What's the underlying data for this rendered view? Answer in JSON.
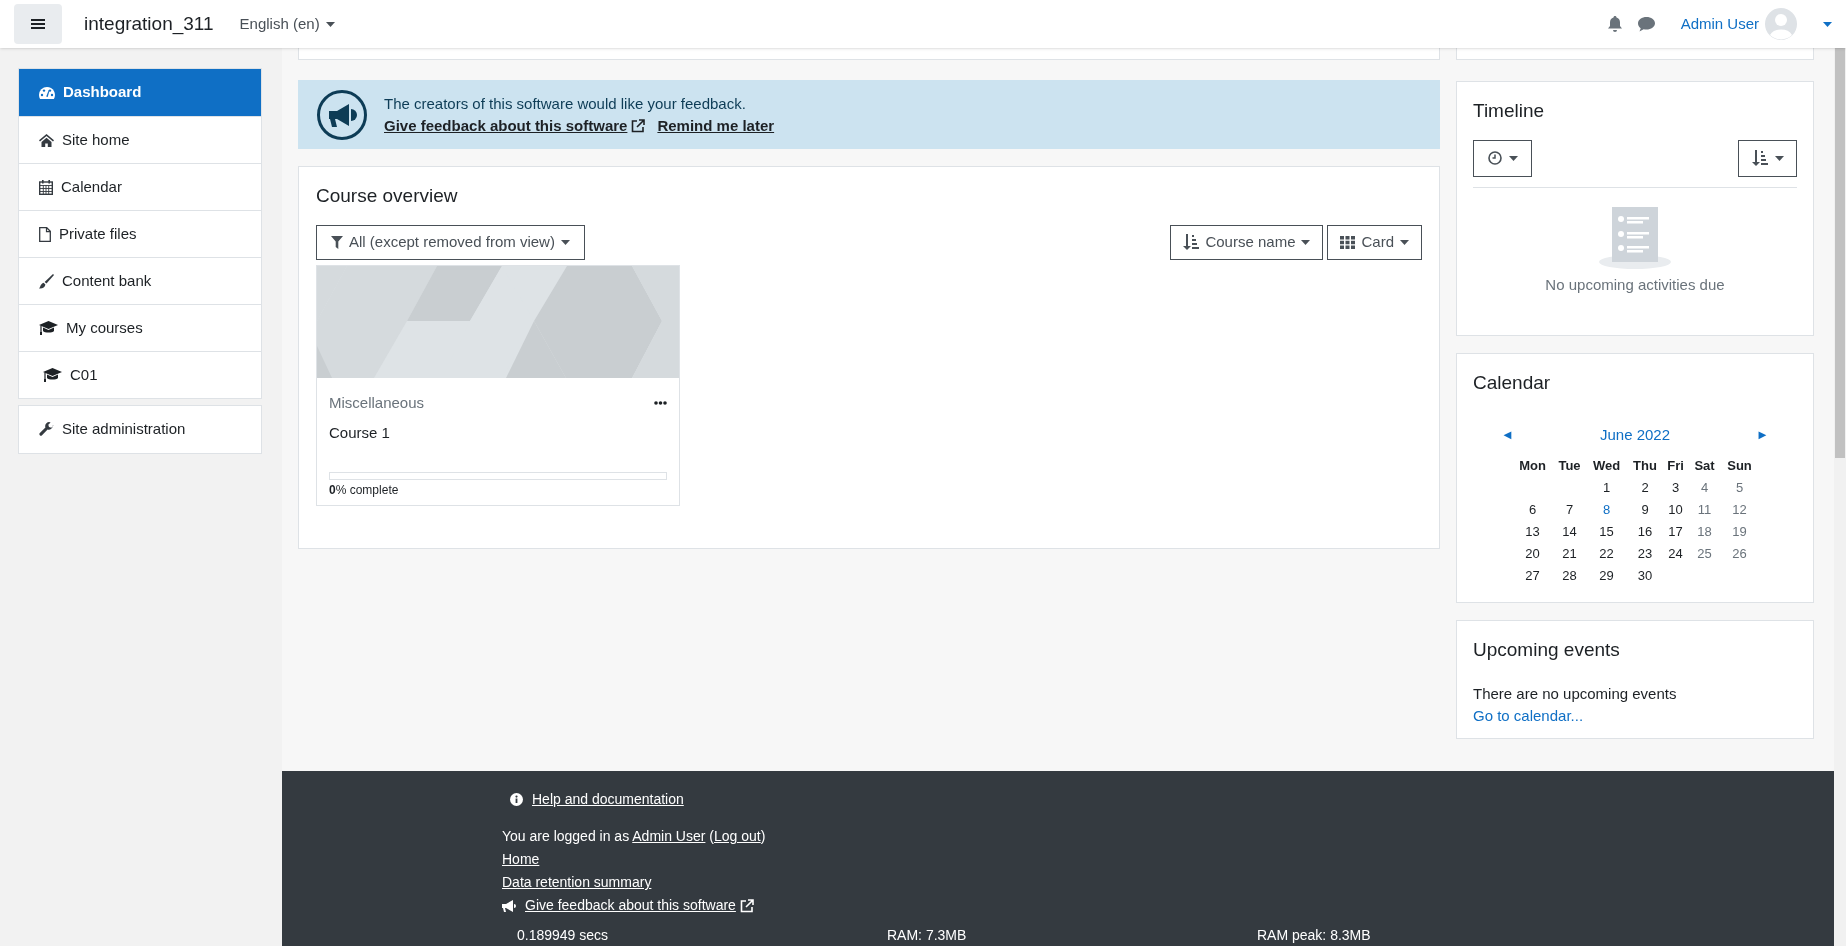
{
  "navbar": {
    "site_name": "integration_311",
    "language": "English (en)",
    "user_name": "Admin User"
  },
  "sidebar": {
    "items": [
      {
        "label": "Dashboard",
        "selected": true
      },
      {
        "label": "Site home",
        "selected": false
      },
      {
        "label": "Calendar",
        "selected": false
      },
      {
        "label": "Private files",
        "selected": false
      },
      {
        "label": "Content bank",
        "selected": false
      },
      {
        "label": "My courses",
        "selected": false,
        "children": [
          {
            "label": "C01",
            "selected": false
          }
        ]
      }
    ],
    "admin_item": {
      "label": "Site administration",
      "selected": false
    }
  },
  "feedback_banner": {
    "message": "The creators of this software would like your feedback.",
    "give_feedback_link": "Give feedback about this software",
    "remind_link": "Remind me later"
  },
  "course_overview": {
    "title": "Course overview",
    "filter": "All (except removed from view)",
    "sort": "Course name",
    "view": "Card",
    "courses": [
      {
        "category": "Miscellaneous",
        "name": "Course 1",
        "level": 0,
        "progress_value": "0",
        "progress_suffix": "% complete"
      }
    ]
  },
  "timeline": {
    "title": "Timeline",
    "empty_message": "No upcoming activities due"
  },
  "calendar": {
    "title": "Calendar",
    "prev": "◄",
    "month": "June 2022",
    "next": "►",
    "weekdays": [
      "Mon",
      "Tue",
      "Wed",
      "Thu",
      "Fri",
      "Sat",
      "Sun"
    ],
    "weeks": [
      [
        {
          "day": "1",
          "kind": "weekday"
        },
        {
          "day": "2",
          "kind": "weekday"
        },
        {
          "day": "3",
          "kind": "weekday"
        },
        {
          "day": "4",
          "kind": "weekend"
        },
        {
          "day": "5",
          "kind": "weekend"
        }
      ],
      [
        {
          "day": "6",
          "kind": "weekday"
        },
        {
          "day": "7",
          "kind": "weekday"
        },
        {
          "day": "8",
          "kind": "today"
        },
        {
          "day": "9",
          "kind": "weekday"
        },
        {
          "day": "10",
          "kind": "weekday"
        },
        {
          "day": "11",
          "kind": "weekend"
        },
        {
          "day": "12",
          "kind": "weekend"
        }
      ],
      [
        {
          "day": "13",
          "kind": "weekday"
        },
        {
          "day": "14",
          "kind": "weekday"
        },
        {
          "day": "15",
          "kind": "weekday"
        },
        {
          "day": "16",
          "kind": "weekday"
        },
        {
          "day": "17",
          "kind": "weekday"
        },
        {
          "day": "18",
          "kind": "weekend"
        },
        {
          "day": "19",
          "kind": "weekend"
        }
      ],
      [
        {
          "day": "20",
          "kind": "weekday"
        },
        {
          "day": "21",
          "kind": "weekday"
        },
        {
          "day": "22",
          "kind": "weekday"
        },
        {
          "day": "23",
          "kind": "weekday"
        },
        {
          "day": "24",
          "kind": "weekday"
        },
        {
          "day": "25",
          "kind": "weekend"
        },
        {
          "day": "26",
          "kind": "weekend"
        }
      ],
      [
        {
          "day": "27",
          "kind": "weekday"
        },
        {
          "day": "28",
          "kind": "weekday"
        },
        {
          "day": "29",
          "kind": "weekday"
        },
        {
          "day": "30",
          "kind": "weekday"
        }
      ]
    ]
  },
  "upcoming_events": {
    "title": "Upcoming events",
    "message": "There are no upcoming events",
    "link": "Go to calendar..."
  },
  "footer": {
    "help_link": "Help and documentation",
    "logged_in": {
      "prefix": "You are logged in as",
      "user": "Admin User",
      "open_paren": "(",
      "logout": "Log out",
      "close_paren": ")"
    },
    "links": [
      "Home",
      "Data retention summary"
    ],
    "feedback_link": "Give feedback about this software",
    "stats": [
      "0.189949 secs",
      "RAM: 7.3MB",
      "RAM peak: 8.3MB"
    ]
  }
}
